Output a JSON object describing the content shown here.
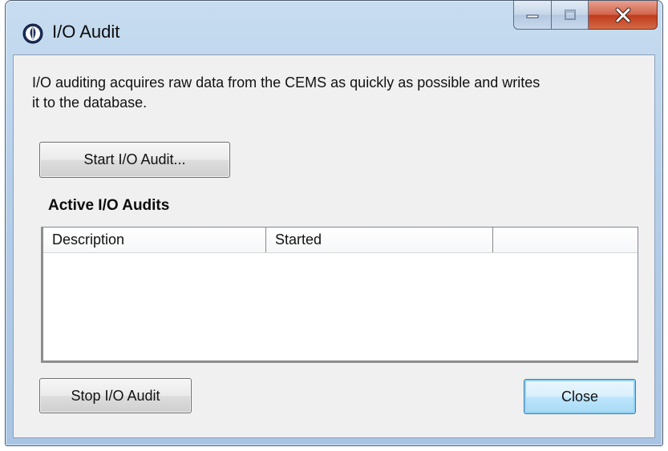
{
  "window": {
    "title": "I/O Audit",
    "icon": "app-leaf-icon",
    "caption_buttons": [
      "minimize-icon",
      "maximize-icon",
      "close-icon"
    ]
  },
  "description": "I/O auditing acquires raw data from the CEMS as quickly as possible and writes it to the database.",
  "buttons": {
    "start": "Start I/O Audit...",
    "stop": "Stop I/O Audit",
    "close": "Close"
  },
  "active_audits": {
    "title": "Active I/O Audits",
    "columns": [
      "Description",
      "Started",
      ""
    ],
    "rows": []
  },
  "colors": {
    "frame": "#b6cfe9",
    "close_button": "#c0391c",
    "client_background": "#f0f0f0",
    "default_button_border": "#3c7fb1"
  }
}
